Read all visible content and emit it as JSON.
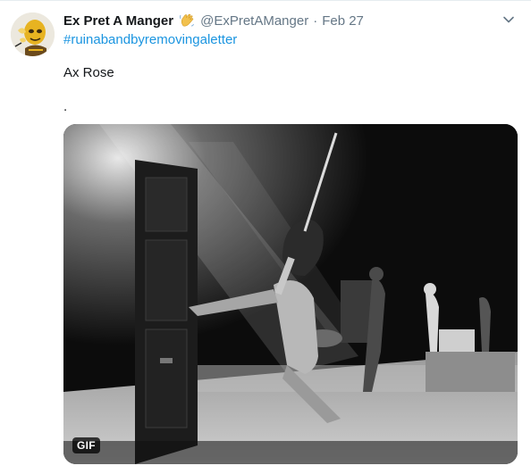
{
  "tweet": {
    "display_name": "Ex Pret A Manger",
    "handle": "@ExPretAManger",
    "separator": "·",
    "timestamp": "Feb 27",
    "hashtag": "#ruinabandbyremovingaletter",
    "text": "Ax Rose",
    "text_dot": ".",
    "media_badge": "GIF",
    "icons": {
      "avatar": "avatar",
      "name_emoji": "waving-hand-icon",
      "menu": "chevron-down-icon"
    },
    "colors": {
      "link": "#1b95e0",
      "secondary_text": "#657786",
      "primary_text": "#14171a"
    }
  }
}
